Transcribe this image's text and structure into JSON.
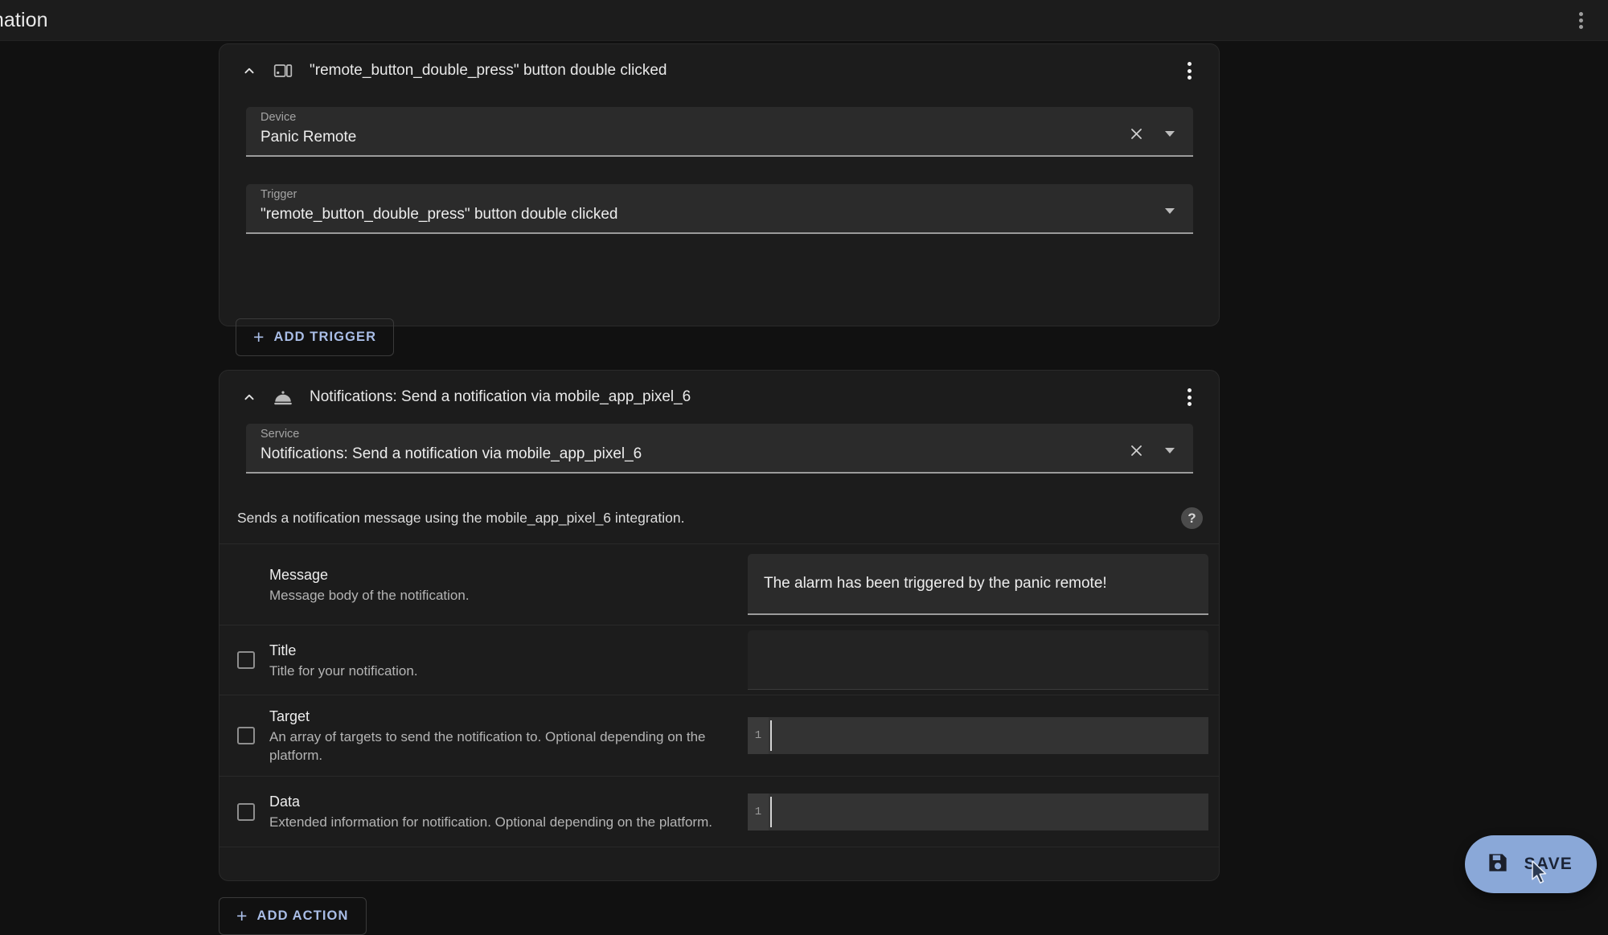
{
  "topbar": {
    "title": "mation",
    "overflow_menu_name": "more-options"
  },
  "trigger_card": {
    "title": "\"remote_button_double_press\" button double clicked",
    "icon": "remote-device-icon",
    "collapse_icon": "chevron-up-icon",
    "menu_icon": "dots-vertical-icon",
    "device_field": {
      "label": "Device",
      "value": "Panic Remote",
      "clear_icon": "close-icon",
      "dropdown_icon": "arrow-drop-down-icon"
    },
    "trigger_field": {
      "label": "Trigger",
      "value": "\"remote_button_double_press\" button double clicked",
      "dropdown_icon": "arrow-drop-down-icon"
    },
    "add_trigger_label": "ADD TRIGGER",
    "add_trigger_plus": "+"
  },
  "action_card": {
    "title": "Notifications: Send a notification via mobile_app_pixel_6",
    "icon": "room-service-bell-icon",
    "collapse_icon": "chevron-up-icon",
    "menu_icon": "dots-vertical-icon",
    "service_field": {
      "label": "Service",
      "value": "Notifications: Send a notification via mobile_app_pixel_6",
      "clear_icon": "close-icon",
      "dropdown_icon": "arrow-drop-down-icon"
    },
    "description": "Sends a notification message using the mobile_app_pixel_6 integration.",
    "help_icon_glyph": "?",
    "params": [
      {
        "name": "Message",
        "description": "Message body of the notification.",
        "input_type": "text",
        "value": "The alarm has been triggered by the panic remote!",
        "has_checkbox": false,
        "checked": false
      },
      {
        "name": "Title",
        "description": "Title for your notification.",
        "input_type": "text",
        "value": "",
        "has_checkbox": true,
        "checked": false
      },
      {
        "name": "Target",
        "description": "An array of targets to send the notification to. Optional depending on the platform.",
        "input_type": "code",
        "value": "",
        "line_number": "1",
        "has_checkbox": true,
        "checked": false
      },
      {
        "name": "Data",
        "description": "Extended information for notification. Optional depending on the platform.",
        "input_type": "code",
        "value": "",
        "line_number": "1",
        "has_checkbox": true,
        "checked": false
      }
    ],
    "add_action_label": "ADD ACTION",
    "add_action_plus": "+"
  },
  "save_fab": {
    "label": "SAVE",
    "icon": "floppy-disk-save-icon"
  },
  "colors": {
    "page_background": "#111111",
    "card_background": "#1c1c1c",
    "field_background": "#2b2b2b",
    "accent_blue": "#a9bde6",
    "fab_background": "#8aa8d8",
    "primary_text": "#ededed",
    "secondary_text": "#b4b4b4"
  }
}
